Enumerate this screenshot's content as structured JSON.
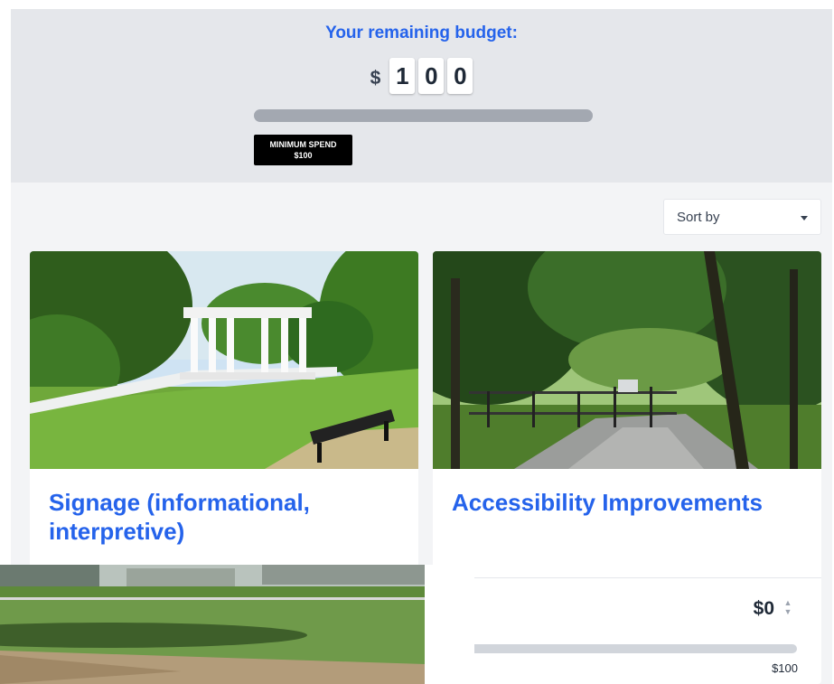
{
  "budget": {
    "title": "Your remaining budget:",
    "currency": "$",
    "digits": [
      "1",
      "0",
      "0"
    ],
    "spent_fraction": 0.0,
    "min_spend_label": "MINIMUM SPEND",
    "min_spend_value": "$100"
  },
  "sort": {
    "label": "Sort by",
    "icon": "chevron-down-icon"
  },
  "cards": [
    {
      "title": "Signage (informational, interpretive)",
      "image": "park-gazebo-bench-photo"
    },
    {
      "title": "Accessibility Improvements",
      "image": "wooded-playground-path-photo",
      "price": "$0",
      "max": "$100",
      "fill_fraction": 0.0
    }
  ],
  "overlay": {
    "image": "baseball-field-photo"
  },
  "colors": {
    "accent": "#2563eb",
    "panel": "#e5e7eb",
    "background": "#f3f4f6"
  }
}
